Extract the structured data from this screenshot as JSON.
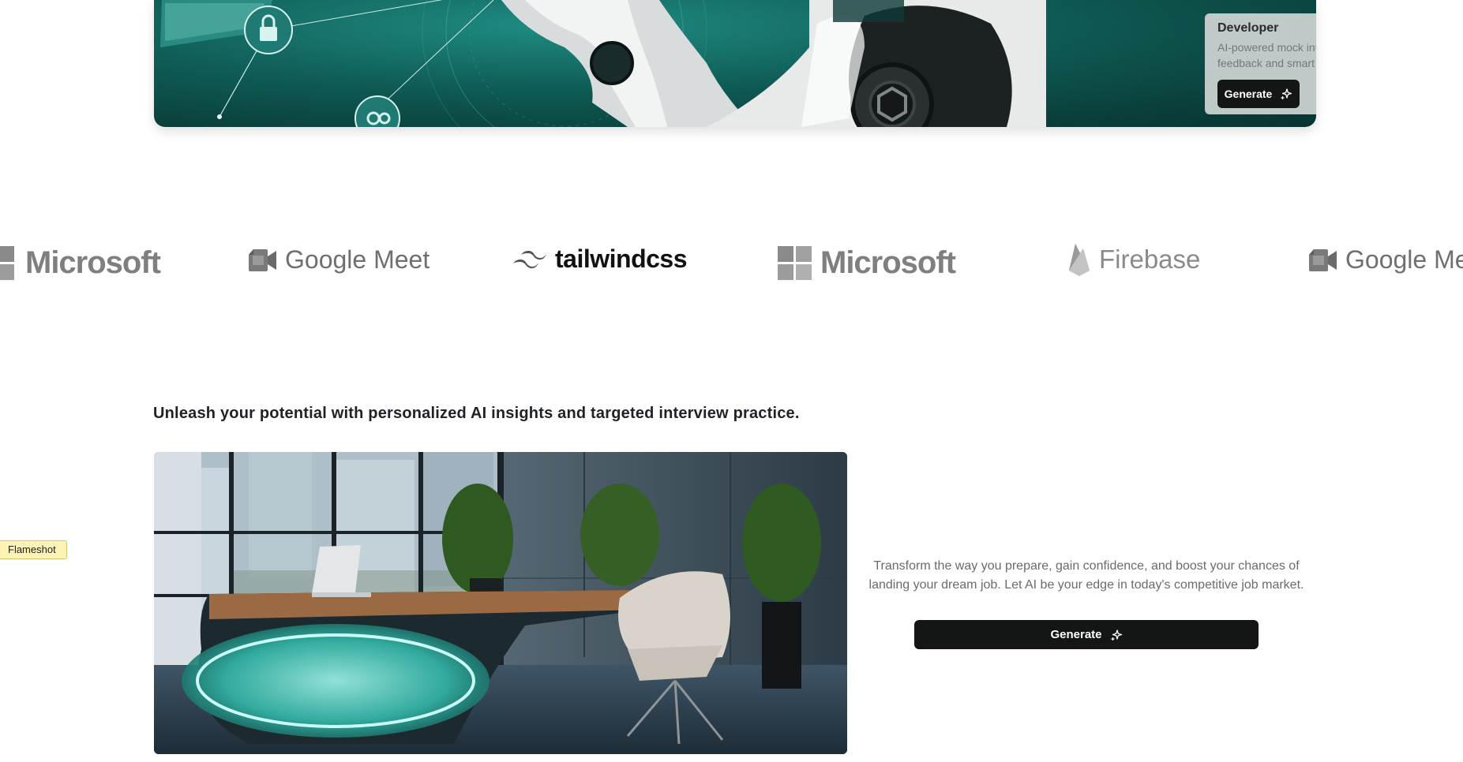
{
  "hero": {
    "card_title": "Developer",
    "card_description": "AI-powered mock interviews with real-time feedback and smart insights.",
    "button_label": "Generate"
  },
  "logos": [
    {
      "name": "Microsoft",
      "icon": "microsoft-logo-icon"
    },
    {
      "name": "Google Meet",
      "icon": "google-meet-logo-icon"
    },
    {
      "name": "tailwindcss",
      "icon": "tailwindcss-logo-icon"
    },
    {
      "name": "Microsoft",
      "icon": "microsoft-logo-icon"
    },
    {
      "name": "Firebase",
      "icon": "firebase-logo-icon"
    },
    {
      "name": "Google Mee",
      "icon": "google-meet-logo-icon"
    }
  ],
  "section": {
    "headline": "Unleash your potential with personalized AI insights and targeted interview practice.",
    "description": "Transform the way you prepare, gain confidence, and boost your chances of landing your dream job. Let AI be your edge in today's competitive job market.",
    "button_label": "Generate"
  },
  "overlay": {
    "flameshot_label": "Flameshot"
  },
  "colors": {
    "button_bg": "#141616",
    "hero_teal": "#0f5b55",
    "accent_glow": "#3fe6d4"
  }
}
